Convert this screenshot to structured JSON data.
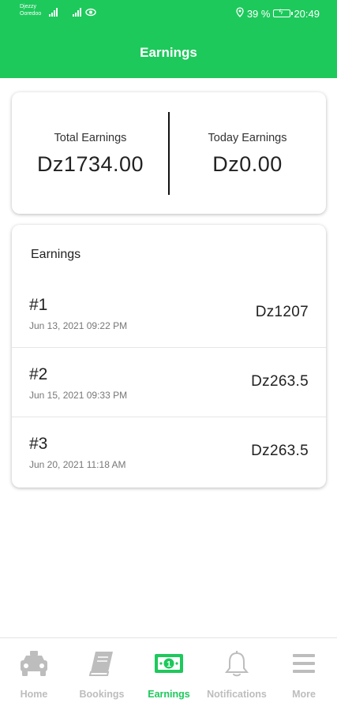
{
  "status_bar": {
    "carrier_1": "Djezzy",
    "carrier_2": "Ooredoo",
    "battery_percent": "39 %",
    "time": "20:49"
  },
  "header": {
    "title": "Earnings"
  },
  "summary": {
    "total_label": "Total Earnings",
    "total_value": "Dz1734.00",
    "today_label": "Today Earnings",
    "today_value": "Dz0.00"
  },
  "earnings": {
    "title": "Earnings",
    "items": [
      {
        "number": "#1",
        "date": "Jun 13, 2021 09:22 PM",
        "amount": "Dz1207"
      },
      {
        "number": "#2",
        "date": "Jun 15, 2021 09:33 PM",
        "amount": "Dz263.5"
      },
      {
        "number": "#3",
        "date": "Jun 20, 2021 11:18 AM",
        "amount": "Dz263.5"
      }
    ]
  },
  "nav": {
    "items": [
      {
        "label": "Home",
        "icon": "taxi-icon",
        "active": false
      },
      {
        "label": "Bookings",
        "icon": "book-icon",
        "active": false
      },
      {
        "label": "Earnings",
        "icon": "money-icon",
        "active": true
      },
      {
        "label": "Notifications",
        "icon": "bell-icon",
        "active": false
      },
      {
        "label": "More",
        "icon": "menu-icon",
        "active": false
      }
    ]
  },
  "colors": {
    "accent": "#1dc95b",
    "inactive": "#bdbdbd",
    "text": "#222222"
  }
}
